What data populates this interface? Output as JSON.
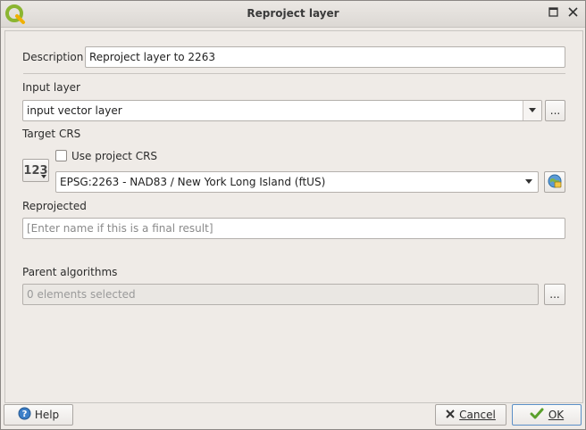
{
  "window": {
    "title": "Reproject layer"
  },
  "description": {
    "label": "Description",
    "value": "Reproject layer to 2263"
  },
  "input_layer": {
    "label": "Input layer",
    "value": "input vector layer",
    "more_label": "..."
  },
  "target_crs": {
    "label": "Target CRS",
    "use_project_crs_label": "Use project CRS",
    "use_project_crs_checked": false,
    "param_type_label": "123",
    "value": "EPSG:2263 - NAD83 / New York Long Island (ftUS)"
  },
  "reprojected": {
    "label": "Reprojected",
    "placeholder": "[Enter name if this is a final result]"
  },
  "parent_algorithms": {
    "label": "Parent algorithms",
    "value": "0 elements selected",
    "more_label": "..."
  },
  "buttons": {
    "help": "Help",
    "cancel": "Cancel",
    "ok": "OK"
  },
  "colors": {
    "accent_green": "#5aa02c",
    "cancel_x": "#333333"
  }
}
